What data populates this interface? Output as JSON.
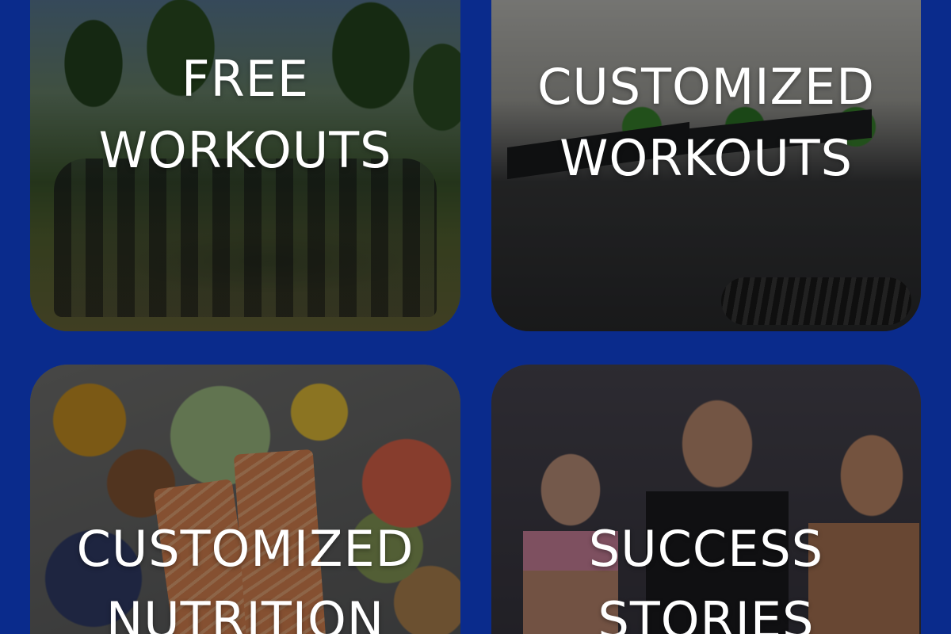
{
  "cards": [
    {
      "id": "free-workouts",
      "line1": "FREE",
      "line2": "WORKOUTS"
    },
    {
      "id": "customized-workouts",
      "line1": "CUSTOMIZED",
      "line2": "WORKOUTS"
    },
    {
      "id": "customized-nutrition",
      "line1": "CUSTOMIZED",
      "line2": "NUTRITION"
    },
    {
      "id": "success-stories",
      "line1": "SUCCESS",
      "line2": "STORIES"
    }
  ],
  "colors": {
    "background": "#0a2b8c",
    "label_text": "#ffffff"
  }
}
